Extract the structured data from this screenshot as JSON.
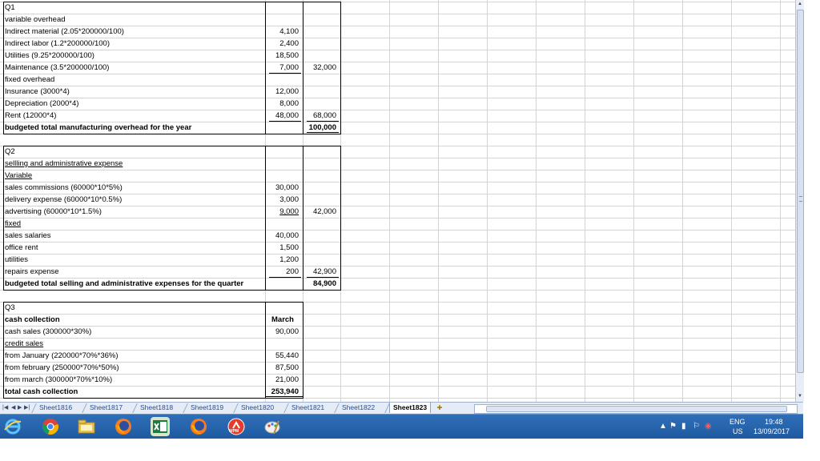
{
  "q1": {
    "title": "Q1",
    "variable_header": "variable overhead",
    "variable_items": [
      {
        "label": "Indirect material (2.05*200000/100)",
        "amount": "4,100"
      },
      {
        "label": "Indirect labor (1.2*200000/100)",
        "amount": "2,400"
      },
      {
        "label": "Utilities  (9.25*200000/100)",
        "amount": "18,500"
      },
      {
        "label": "Maintenance  (3.5*200000/100)",
        "amount": "7,000"
      }
    ],
    "variable_total": "32,000",
    "fixed_header": "fixed overhead",
    "fixed_items": [
      {
        "label": "Insurance  (3000*4)",
        "amount": "12,000"
      },
      {
        "label": "Depreciation  (2000*4)",
        "amount": "8,000"
      },
      {
        "label": "Rent  (12000*4)",
        "amount": "48,000"
      }
    ],
    "fixed_total": "68,000",
    "total_label": "budgeted total manufacturing overhead for the year",
    "total_value": "100,000"
  },
  "q2": {
    "title": "Q2",
    "heading": "sellling and administrative expense",
    "variable_header": "Variable",
    "variable_items": [
      {
        "label": "sales commissions  (60000*10*5%)",
        "amount": "30,000"
      },
      {
        "label": "delivery expense  (60000*10*0.5%)",
        "amount": "3,000"
      },
      {
        "label": "advertising  (60000*10*1.5%)",
        "amount": "9,000"
      }
    ],
    "variable_total": "42,000",
    "fixed_header": "fixed",
    "fixed_items": [
      {
        "label": "sales salaries",
        "amount": "40,000"
      },
      {
        "label": "office rent",
        "amount": "1,500"
      },
      {
        "label": "utilities",
        "amount": "1,200"
      },
      {
        "label": "repairs expense",
        "amount": "200"
      }
    ],
    "fixed_total": "42,900",
    "total_label": "budgeted total selling and administrative expenses for the quarter",
    "total_value": "84,900"
  },
  "q3": {
    "title": "Q3",
    "heading": "cash collection",
    "column_header": "March",
    "cash_sales_label": "cash sales  (300000*30%)",
    "cash_sales_value": "90,000",
    "credit_header": "credit sales",
    "credit_items": [
      {
        "label": "from January (220000*70%*36%)",
        "amount": "55,440"
      },
      {
        "label": "from february (250000*70%*50%)",
        "amount": "87,500"
      },
      {
        "label": "from march (300000*70%*10%)",
        "amount": "21,000"
      }
    ],
    "total_label": "total cash collection",
    "total_value": "253,940"
  },
  "sheet_tabs": [
    "Sheet1816",
    "Sheet1817",
    "Sheet1818",
    "Sheet1819",
    "Sheet1820",
    "Sheet1821",
    "Sheet1822",
    "Sheet1823"
  ],
  "active_tab": "Sheet1823",
  "taskbar": {
    "apps": [
      "internet-explorer-icon",
      "chrome-icon",
      "file-explorer-icon",
      "firefox-icon",
      "excel-icon",
      "firefox-icon",
      "wpm-icon",
      "paint-icon"
    ],
    "wpm_label": "WPM",
    "lang_top": "ENG",
    "lang_bottom": "US",
    "time": "19:48",
    "date": "13/09/2017"
  }
}
